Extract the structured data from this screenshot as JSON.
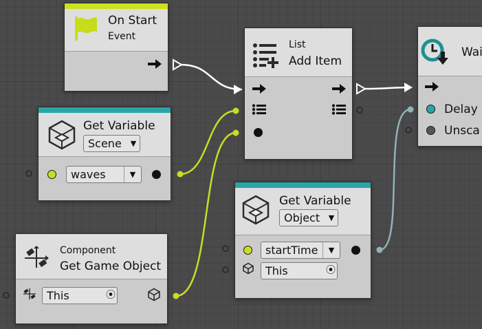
{
  "colors": {
    "event_green": "#cde11c",
    "variable_teal": "#2aa5a7",
    "wire_control": "#ffffff",
    "wire_list": "#c9dd24",
    "wire_float": "#92b2ba",
    "node_bg": "#cbcbcb",
    "header_bg": "#dedede",
    "canvas_bg": "#4a4a4a"
  },
  "nodes": {
    "on_start": {
      "title": "On Start",
      "subtitle": "Event",
      "icon": "flag-icon"
    },
    "add_item": {
      "category": "List",
      "title": "Add Item",
      "icon": "list-add-icon"
    },
    "wait": {
      "title_visible": "Wai",
      "icon": "clock-icon",
      "inputs": [
        "Delay",
        "Unsca"
      ]
    },
    "get_var_scene": {
      "title": "Get Variable",
      "kind": "Scene",
      "name": "waves",
      "icon": "cube-icon"
    },
    "get_var_object": {
      "title": "Get Variable",
      "kind": "Object",
      "name": "startTime",
      "target": "This",
      "icon": "cube-icon"
    },
    "get_game_object": {
      "category": "Component",
      "title": "Get Game Object",
      "target": "This",
      "icon": "transform-icon",
      "output_icon": "cube-icon"
    }
  },
  "dropdown_arrow": "▼",
  "target_glyph": "⦿"
}
